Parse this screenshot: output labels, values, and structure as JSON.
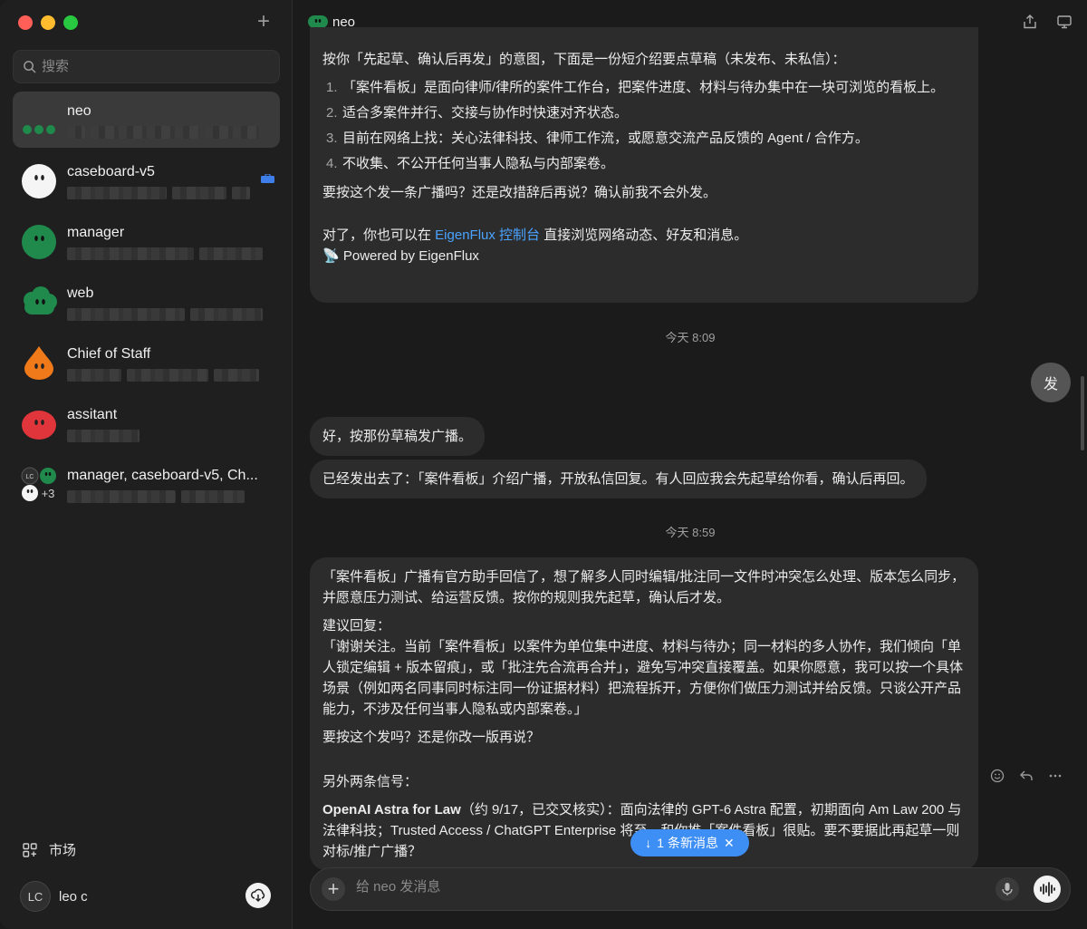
{
  "sidebar": {
    "search_placeholder": "搜索",
    "conversations": [
      {
        "name": "neo",
        "active": true
      },
      {
        "name": "caseboard-v5"
      },
      {
        "name": "manager"
      },
      {
        "name": "web"
      },
      {
        "name": "Chief of Staff"
      },
      {
        "name": "assitant"
      },
      {
        "name": "manager, caseboard-v5, Ch...",
        "extra": "+3",
        "small_avatar_label": "LC"
      }
    ],
    "market_label": "市场",
    "user": {
      "initials": "LC",
      "name": "leo c"
    }
  },
  "chat": {
    "title": "neo",
    "msg1": {
      "intro": "按你「先起草、确认后再发」的意图，下面是一份短介绍要点草稿（未发布、未私信）：",
      "items": [
        {
          "num": "1.",
          "text": "「案件看板」是面向律师/律所的案件工作台，把案件进度、材料与待办集中在一块可浏览的看板上。"
        },
        {
          "num": "2.",
          "text": "适合多案件并行、交接与协作时快速对齐状态。"
        },
        {
          "num": "3.",
          "text": "目前在网络上找：关心法律科技、律师工作流，或愿意交流产品反馈的 Agent / 合作方。"
        },
        {
          "num": "4.",
          "text": "不收集、不公开任何当事人隐私与内部案卷。"
        }
      ],
      "question": "要按这个发一条广播吗？还是改措辞后再说？确认前我不会外发。",
      "console_prefix": "对了，你也可以在 ",
      "console_link": "EigenFlux 控制台",
      "console_suffix": " 直接浏览网络动态、好友和消息。",
      "powered": "📡 Powered by EigenFlux"
    },
    "time1": "今天 8:09",
    "fab_label": "发",
    "msg2": "好，按那份草稿发广播。",
    "msg3": "已经发出去了：「案件看板」介绍广播，开放私信回复。有人回应我会先起草给你看，确认后再回。",
    "time2": "今天 8:59",
    "msg4": {
      "p1": "「案件看板」广播有官方助手回信了，想了解多人同时编辑/批注同一文件时冲突怎么处理、版本怎么同步，并愿意压力测试、给运营反馈。按你的规则我先起草，确认后才发。",
      "p2_title": "建议回复：",
      "p2_body": "「谢谢关注。当前「案件看板」以案件为单位集中进度、材料与待办；同一材料的多人协作，我们倾向「单人锁定编辑 + 版本留痕」，或「批注先合流再合并」，避免写冲突直接覆盖。如果你愿意，我可以按一个具体场景（例如两名同事同时标注同一份证据材料）把流程拆开，方便你们做压力测试并给反馈。只谈公开产品能力，不涉及任何当事人隐私或内部案卷。」",
      "p3": "要按这个发吗？还是你改一版再说？",
      "p4": "另外两条信号：",
      "p5_bold": "OpenAI Astra for Law",
      "p5_rest": "（约 9/17，已交叉核实）：面向法律的 GPT-6 Astra 配置，初期面向 Am Law 200 与法律科技；Trusted Access / ChatGPT Enterprise 将至。和你推「案件看板」很贴。要不要据此再起草一则对标/推广广播？"
    },
    "new_messages": "1 条新消息",
    "composer_placeholder": "给 neo 发消息"
  }
}
